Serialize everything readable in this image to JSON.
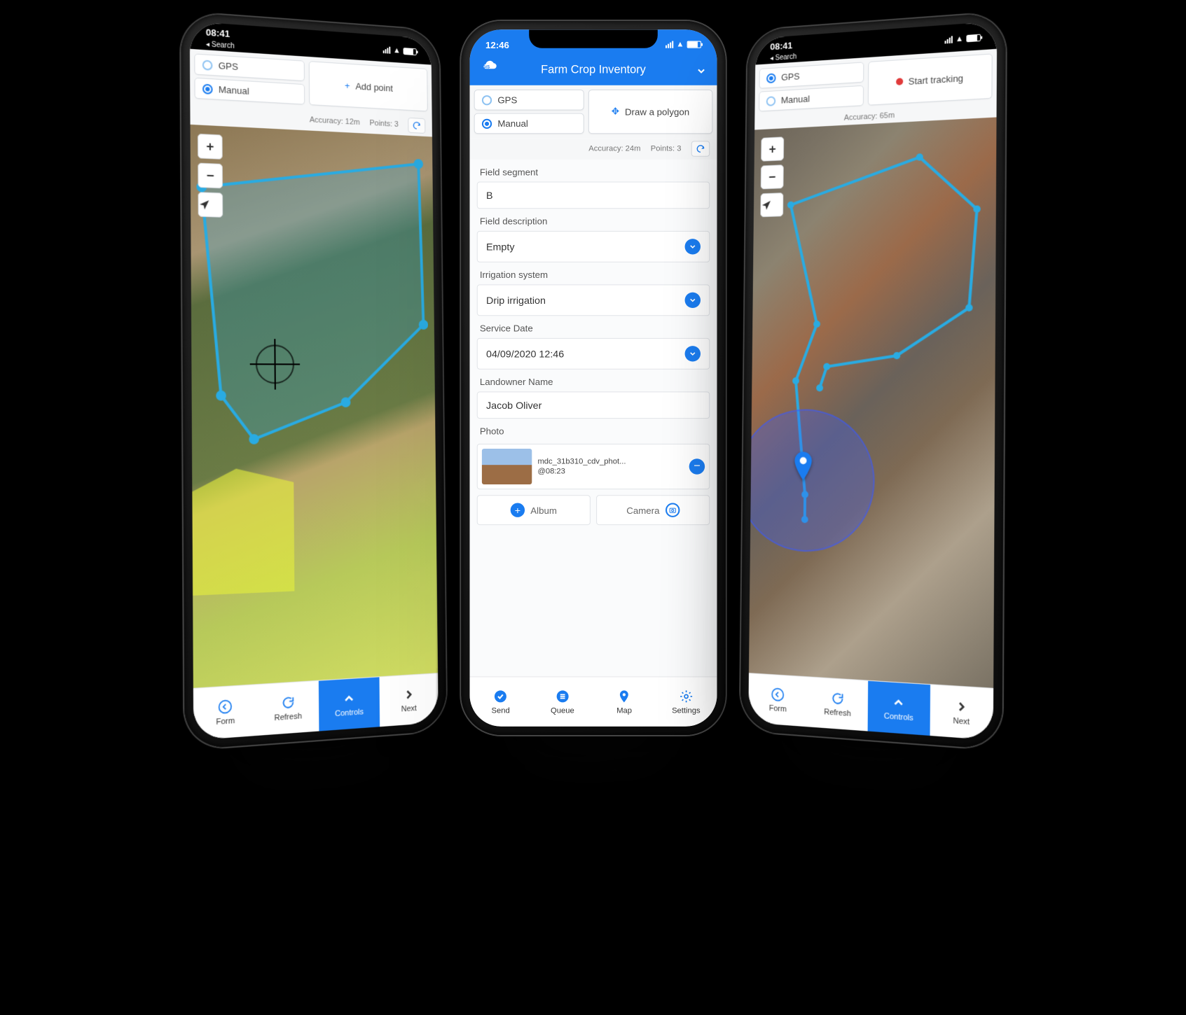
{
  "colors": {
    "primary": "#1a7cf0",
    "danger": "#e03a3a"
  },
  "status": {
    "time_left": "08:41",
    "time_mid": "12:46",
    "time_right": "08:41",
    "back_search": "Search"
  },
  "toolbar": {
    "gps_label": "GPS",
    "manual_label": "Manual",
    "add_point_label": "Add point",
    "draw_polygon_label": "Draw a polygon",
    "start_tracking_label": "Start tracking"
  },
  "metrics": {
    "accuracy_label_left": "Accuracy: 12m",
    "points_label_left": "Points: 3",
    "accuracy_label_mid": "Accuracy: 24m",
    "points_label_mid": "Points: 3",
    "accuracy_label_right": "Accuracy: 65m"
  },
  "mid_header": {
    "title": "Farm Crop Inventory"
  },
  "form": {
    "field_segment_label": "Field segment",
    "field_segment_value": "B",
    "field_description_label": "Field description",
    "field_description_value": "Empty",
    "irrigation_label": "Irrigation system",
    "irrigation_value": "Drip irrigation",
    "service_date_label": "Service Date",
    "service_date_value": "04/09/2020 12:46",
    "landowner_label": "Landowner Name",
    "landowner_value": "Jacob Oliver",
    "photo_label": "Photo",
    "photo_file_line1": "mdc_31b310_cdv_phot...",
    "photo_file_line2": "@08:23",
    "album_label": "Album",
    "camera_label": "Camera"
  },
  "tabs_map": {
    "form": "Form",
    "refresh": "Refresh",
    "controls": "Controls",
    "next": "Next"
  },
  "tabs_form": {
    "send": "Send",
    "queue": "Queue",
    "map": "Map",
    "settings": "Settings"
  }
}
